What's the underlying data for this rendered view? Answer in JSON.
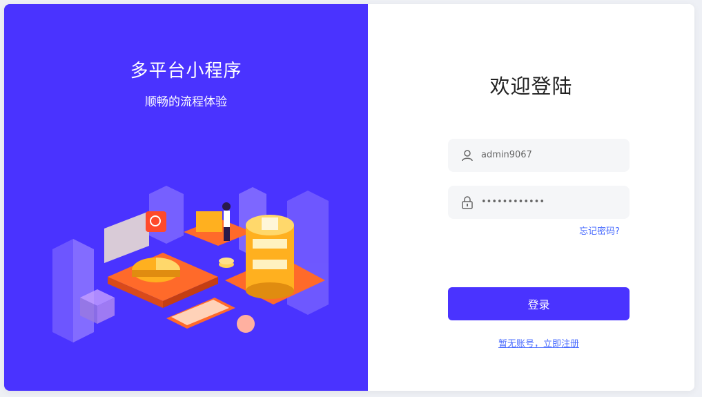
{
  "left": {
    "title": "多平台小程序",
    "subtitle": "顺畅的流程体验"
  },
  "login": {
    "heading": "欢迎登陆",
    "username_value": "admin9067",
    "password_mask": "••••••••••••",
    "forgot_label": "忘记密码?",
    "submit_label": "登录",
    "register_label": "暂无账号，立即注册"
  },
  "icons": {
    "user": "user-icon",
    "lock": "lock-icon"
  },
  "colors": {
    "brand": "#4a33ff",
    "link": "#4a6cff",
    "field_bg": "#f5f6f8"
  }
}
